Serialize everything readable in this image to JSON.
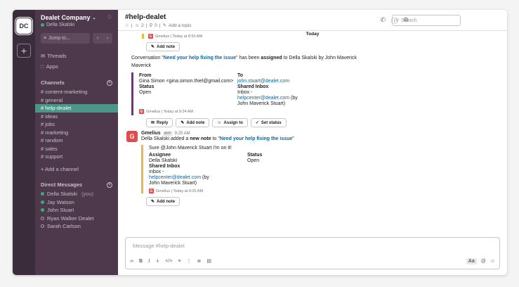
{
  "workspace": {
    "initials": "DC"
  },
  "team": {
    "name": "Dealet Company",
    "user": "Della Skalski"
  },
  "jump_to": "Jump to...",
  "sidebar": {
    "links": [
      "Threads",
      "Apps"
    ],
    "channels_header": "Channels",
    "channels": [
      "# content-marketing",
      "# general",
      "# help-dealet",
      "# ideas",
      "# jobs",
      "# marketing",
      "# random",
      "# sales",
      "# support"
    ],
    "add_channel": "+ Add a channel",
    "dm_header": "Direct Messages",
    "dms": [
      {
        "name": "Della Skalski",
        "suffix": "(you)",
        "online": true
      },
      {
        "name": "Jay Watson",
        "suffix": "",
        "online": true
      },
      {
        "name": "John Stuart",
        "suffix": "",
        "online": true
      },
      {
        "name": "Ryan Walker Dealet",
        "suffix": "",
        "online": false
      },
      {
        "name": "Sarah Carlson",
        "suffix": "",
        "online": false
      }
    ]
  },
  "header": {
    "title": "#help-dealet",
    "members": "2",
    "pins": "0",
    "topic": "Add a topic",
    "search_placeholder": "Search"
  },
  "messages": {
    "today": "Today",
    "m1": {
      "meta": "Gmelius | Today at 8:53 AM",
      "button": "Add note"
    },
    "m2": {
      "text_pre": "Conversation \"",
      "link": "Need your help fixing the issue",
      "text_mid": "\" has been ",
      "bold": "assigned",
      "text_post": " to Della Skalski by John Maverick",
      "from_label": "From",
      "from_value": "Gina Simon <gina.simon.thiel@gmail.com>",
      "to_label": "To",
      "to_value": "john.stuart@dealet.com",
      "status_label": "Status",
      "status_value": "Open",
      "inbox_label": "Shared Inbox",
      "inbox_line1": "Inbox -",
      "inbox_link": "helpcenter@dealet.com",
      "inbox_line2": " (by",
      "inbox_line3": "John Maverick Stuart)",
      "meta": "Gmelius | Today at 9:24 AM",
      "buttons": [
        "Reply",
        "Add note",
        "Assign to",
        "Set status"
      ]
    },
    "m3": {
      "author": "Gmelius",
      "app_tag": "APP",
      "time": "9:25 AM",
      "text_pre": "Della Skalski added a ",
      "bold": "new note",
      "text_mid": " to \"",
      "link": "Need your help fixing the issue",
      "text_post": "\"",
      "note": "Sure @John Maverick Stuart I'm on it!",
      "assignee_label": "Assignee",
      "assignee_value": "Della Skalski",
      "status_label": "Status",
      "status_value": "Open",
      "inbox_label": "Shared Inbox",
      "inbox_line1": "Inbox -",
      "inbox_link": "helpcenter@dealet.com",
      "inbox_line2": " (by",
      "inbox_line3": "John Maverick Stuart)",
      "meta": "Gmelius | Today at 9:25 AM",
      "button": "Add note"
    }
  },
  "composer": {
    "placeholder": "Message #help-dealet",
    "aa": "Aa"
  }
}
